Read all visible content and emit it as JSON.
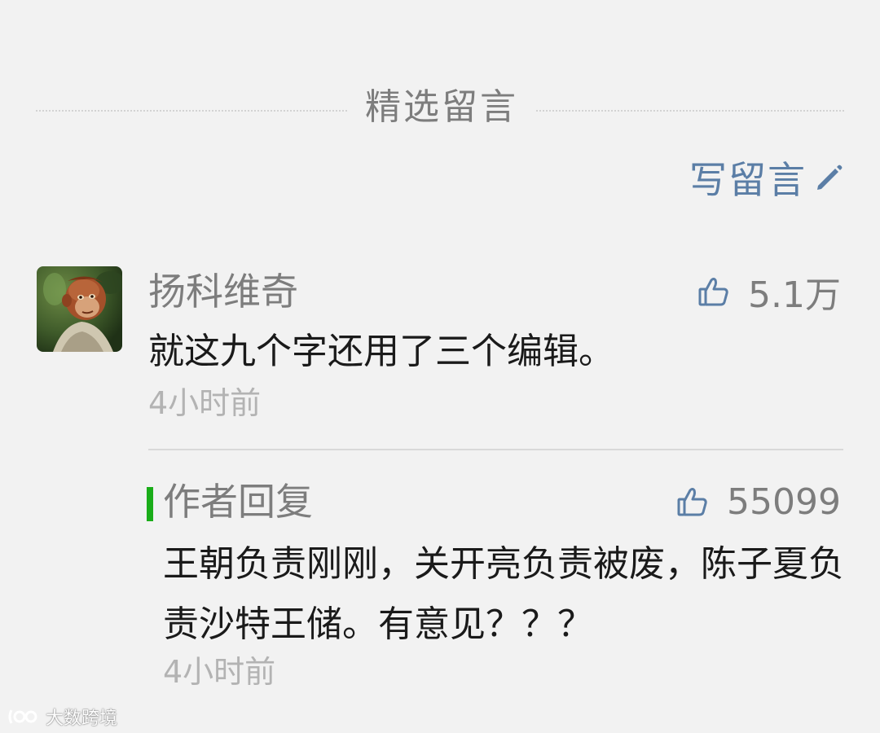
{
  "section": {
    "title": "精选留言"
  },
  "write_comment": {
    "label": "写留言",
    "icon": "pencil-icon",
    "color": "#5b7ea6"
  },
  "comment": {
    "nickname": "扬科维奇",
    "avatar": "monkey-avatar",
    "likes": "5.1万",
    "text": "就这九个字还用了三个编辑。",
    "time": "4小时前"
  },
  "reply": {
    "label": "作者回复",
    "likes": "55099",
    "text": "王朝负责刚刚，关开亮负责被废，陈子夏负责沙特王储。有意见？？？",
    "time": "4小时前",
    "accent_color": "#1aad19"
  },
  "watermark": {
    "text": "大数跨境"
  }
}
